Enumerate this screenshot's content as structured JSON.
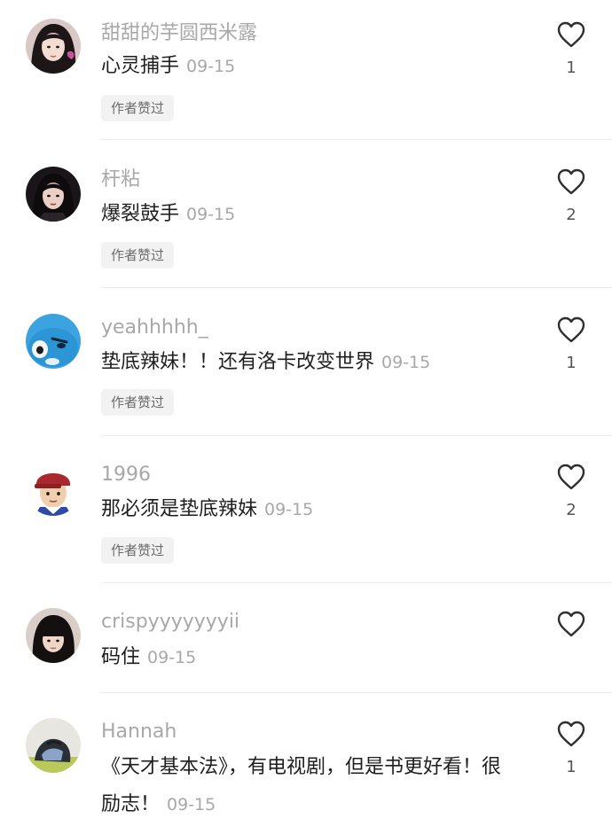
{
  "comments": [
    {
      "username": "甜甜的芋圆西米露",
      "text": "心灵捕手",
      "time": "09-15",
      "badge": "作者赞过",
      "likes": "1",
      "avatar": "avatar-girl-long-hair"
    },
    {
      "username": "杆粘",
      "text": "爆裂鼓手",
      "time": "09-15",
      "badge": "作者赞过",
      "likes": "2",
      "avatar": "avatar-girl-dark"
    },
    {
      "username": "yeahhhhh_",
      "text": "垫底辣妹！！还有洛卡改变世界",
      "time": "09-15",
      "badge": "作者赞过",
      "likes": "1",
      "avatar": "avatar-blue-cartoon"
    },
    {
      "username": "1996",
      "text": "那必须是垫底辣妹",
      "time": "09-15",
      "badge": "作者赞过",
      "likes": "2",
      "avatar": "avatar-boy-red-cap"
    },
    {
      "username": "crispyyyyyyyii",
      "text": "码住",
      "time": "09-15",
      "likes": "",
      "avatar": "avatar-girl-bangs"
    },
    {
      "username": "Hannah",
      "text": "《天才基本法》，有电视剧，但是书更好看！很励志！",
      "time": "09-15",
      "likes": "1",
      "avatar": "avatar-clothes-pile"
    }
  ],
  "colors": {
    "username": "#a8a8a8",
    "text": "#1e1e1e",
    "badge_bg": "#f2f2f2",
    "divider": "#ececec"
  },
  "icons": {
    "like": "heart-outline-icon"
  }
}
